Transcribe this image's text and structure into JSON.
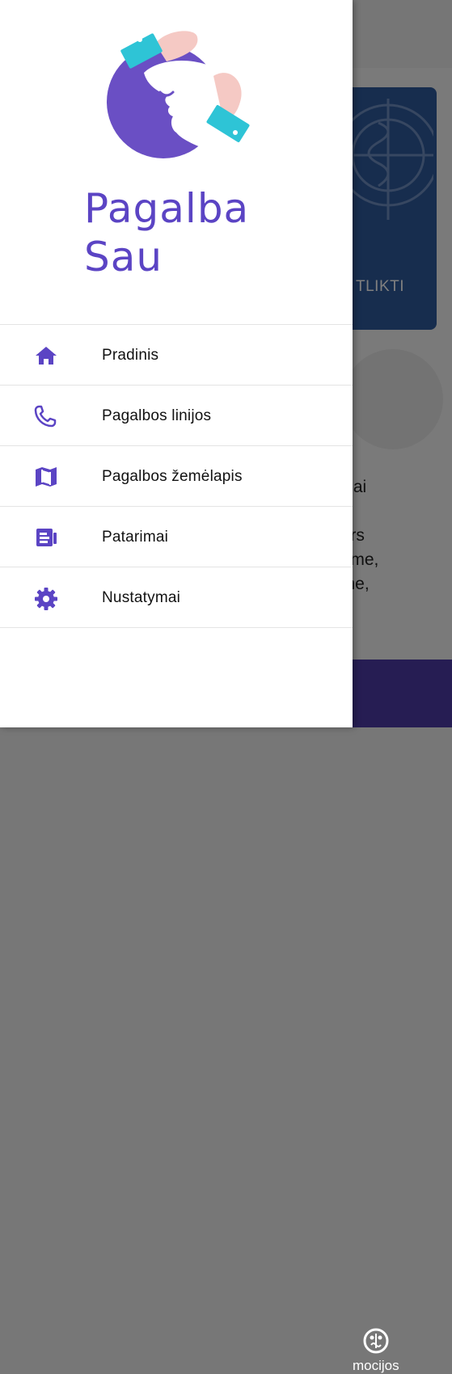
{
  "app": {
    "brand_line1": "Pagalba",
    "brand_line2": "Sau"
  },
  "colors": {
    "accent": "#5b44c4",
    "logo_pink": "#f5c9c4",
    "logo_cyan": "#2ec4d6",
    "logo_purple": "#6a4fc4"
  },
  "drawer": {
    "items": [
      {
        "label": "Pradinis",
        "icon": "home-icon"
      },
      {
        "label": "Pagalbos linijos",
        "icon": "phone-icon"
      },
      {
        "label": "Pagalbos žemėlapis",
        "icon": "map-icon"
      },
      {
        "label": "Patarimai",
        "icon": "article-icon"
      },
      {
        "label": "Nustatymai",
        "icon": "gear-icon"
      }
    ]
  },
  "background": {
    "card_button_text": "TLIKTI",
    "text_lines": [
      "usiai",
      ".",
      "hors",
      "home,",
      "ame,"
    ],
    "bottom_nav_label": "mocijos",
    "bottom_nav_icon": "emotions-icon"
  }
}
